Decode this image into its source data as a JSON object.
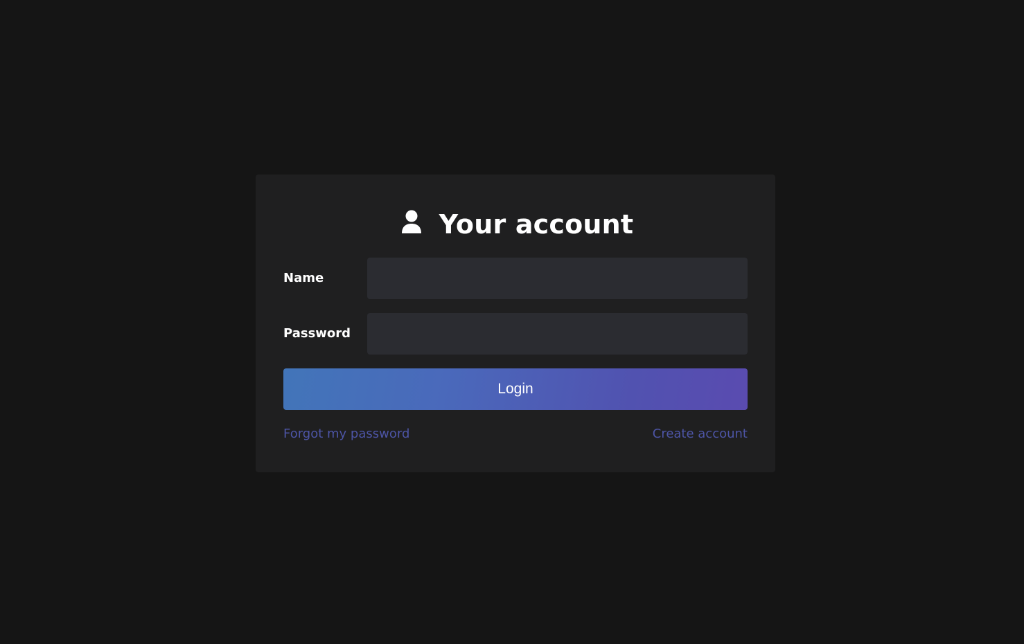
{
  "card": {
    "title": "Your account",
    "title_icon": "user-icon"
  },
  "form": {
    "name_label": "Name",
    "name_value": "",
    "password_label": "Password",
    "password_value": "",
    "login_label": "Login"
  },
  "links": {
    "forgot": "Forgot my password",
    "create": "Create account"
  },
  "colors": {
    "background": "#151515",
    "card": "#1f1f20",
    "input": "#2b2c31",
    "link": "#4d55a6",
    "button_gradient_start": "#4275b9",
    "button_gradient_end": "#5a4bb0"
  }
}
